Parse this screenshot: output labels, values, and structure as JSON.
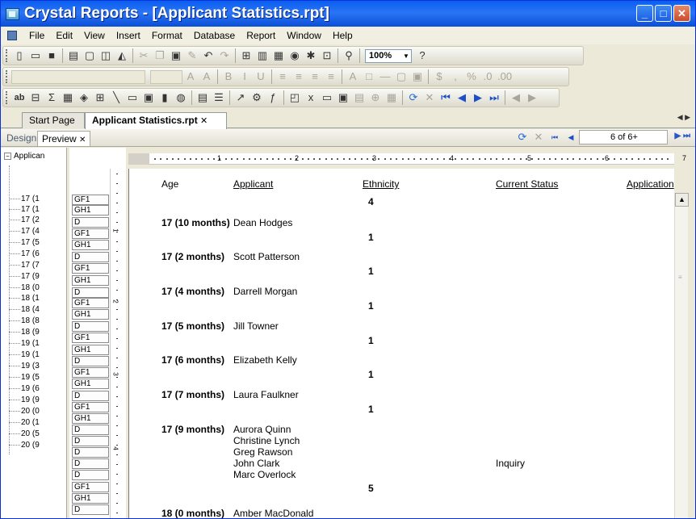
{
  "window": {
    "title": "Crystal Reports - [Applicant Statistics.rpt]",
    "buttons": [
      "_",
      "□",
      "✕"
    ]
  },
  "menu": [
    "File",
    "Edit",
    "View",
    "Insert",
    "Format",
    "Database",
    "Report",
    "Window",
    "Help"
  ],
  "toolbar": {
    "zoom": "100%"
  },
  "doc_tabs": {
    "start": "Start Page",
    "active": "Applicant Statistics.rpt",
    "close": "✕"
  },
  "view_tabs": {
    "design": "Design",
    "preview": "Preview",
    "preview_close": "✕",
    "page": "6 of 6+"
  },
  "group_tree": {
    "root": "Applican",
    "items": [
      "17 (1",
      "17 (1",
      "17 (2",
      "17 (4",
      "17 (5",
      "17 (6",
      "17 (7",
      "17 (9",
      "18 (0",
      "18 (1",
      "18 (4",
      "18 (8",
      "18 (9",
      "19 (1",
      "19 (1",
      "19 (3",
      "19 (5",
      "19 (6",
      "19 (9",
      "20 (0",
      "20 (1",
      "20 (5",
      "20 (9"
    ]
  },
  "ruler": {
    "numbers": [
      "1",
      "2",
      "3",
      "4",
      "5",
      "6",
      "7"
    ]
  },
  "section_labels": [
    "GF1",
    "GH1",
    "D",
    "GF1",
    "GH1",
    "D",
    "GF1",
    "GH1",
    "D",
    "GF1",
    "GH1",
    "D",
    "GF1",
    "GH1",
    "D",
    "GF1",
    "GH1",
    "D",
    "GF1",
    "GH1",
    "D",
    "D",
    "D",
    "D",
    "D",
    "GF1",
    "GH1",
    "D"
  ],
  "report": {
    "headers": {
      "age": "Age",
      "applicant": "Applicant",
      "ethnicity": "Ethnicity",
      "status": "Current Status",
      "application": "Application"
    },
    "first_count": "4",
    "groups": [
      {
        "age": "17 (10 months)",
        "names": [
          "Dean Hodges"
        ],
        "statuses": [
          ""
        ],
        "count": "1"
      },
      {
        "age": "17 (2 months)",
        "names": [
          "Scott Patterson"
        ],
        "statuses": [
          ""
        ],
        "count": "1"
      },
      {
        "age": "17 (4 months)",
        "names": [
          "Darrell Morgan"
        ],
        "statuses": [
          ""
        ],
        "count": "1"
      },
      {
        "age": "17 (5 months)",
        "names": [
          "Jill Towner"
        ],
        "statuses": [
          ""
        ],
        "count": "1"
      },
      {
        "age": "17 (6 months)",
        "names": [
          "Elizabeth Kelly"
        ],
        "statuses": [
          ""
        ],
        "count": "1"
      },
      {
        "age": "17 (7 months)",
        "names": [
          "Laura Faulkner"
        ],
        "statuses": [
          ""
        ],
        "count": "1"
      },
      {
        "age": "17 (9 months)",
        "names": [
          "Aurora Quinn",
          "Christine Lynch",
          "Greg Rawson",
          "John Clark",
          "Marc Overlock"
        ],
        "statuses": [
          "",
          "",
          "",
          "Inquiry",
          ""
        ],
        "count": "5"
      },
      {
        "age": "18 (0 months)",
        "names": [
          "Amber MacDonald"
        ],
        "statuses": [
          ""
        ],
        "count": ""
      }
    ]
  }
}
